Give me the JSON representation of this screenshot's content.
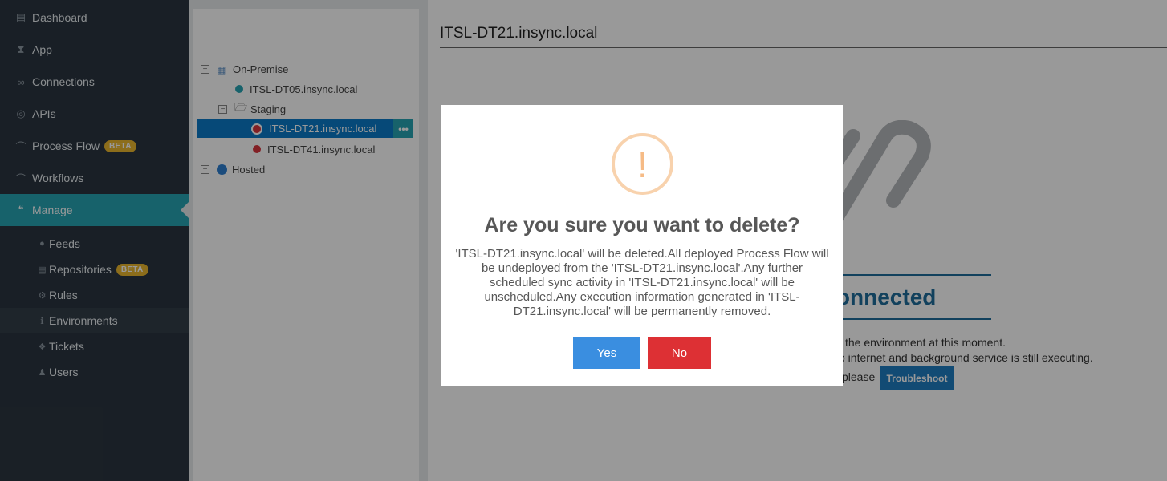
{
  "sidebar": {
    "items": [
      {
        "label": "Dashboard",
        "icon": "database-icon"
      },
      {
        "label": "App",
        "icon": "tag-icon"
      },
      {
        "label": "Connections",
        "icon": "link-icon"
      },
      {
        "label": "APIs",
        "icon": "globe-icon"
      },
      {
        "label": "Process Flow",
        "icon": "flow-icon",
        "badge": "BETA"
      },
      {
        "label": "Workflows",
        "icon": "workflow-icon"
      },
      {
        "label": "Manage",
        "icon": "comments-icon"
      }
    ],
    "subitems": [
      {
        "label": "Feeds",
        "icon": "comment-icon"
      },
      {
        "label": "Repositories",
        "icon": "database-icon",
        "badge": "BETA"
      },
      {
        "label": "Rules",
        "icon": "gear-icon"
      },
      {
        "label": "Environments",
        "icon": "info-icon"
      },
      {
        "label": "Tickets",
        "icon": "ticket-icon"
      },
      {
        "label": "Users",
        "icon": "user-icon"
      }
    ],
    "active_color": "#27a3b3"
  },
  "tree": {
    "on_premise": "On-Premise",
    "dt05": "ITSL-DT05.insync.local",
    "staging": "Staging",
    "dt21": "ITSL-DT21.insync.local",
    "dt41": "ITSL-DT41.insync.local",
    "hosted": "Hosted",
    "more": "•••"
  },
  "main": {
    "title": "ITSL-DT21.insync.local",
    "disconnected": "isconnected",
    "line1": "the environment at this moment.",
    "line2": "o internet and background service is still executing.",
    "line3": "please",
    "troubleshoot": "Troubleshoot"
  },
  "modal": {
    "icon": "!",
    "title": "Are you sure you want to delete?",
    "message": "'ITSL-DT21.insync.local' will be deleted.All deployed Process Flow will be undeployed from the 'ITSL-DT21.insync.local'.Any further scheduled sync activity in 'ITSL-DT21.insync.local' will be unscheduled.Any execution information generated in 'ITSL-DT21.insync.local' will be permanently removed.",
    "yes": "Yes",
    "no": "No"
  }
}
